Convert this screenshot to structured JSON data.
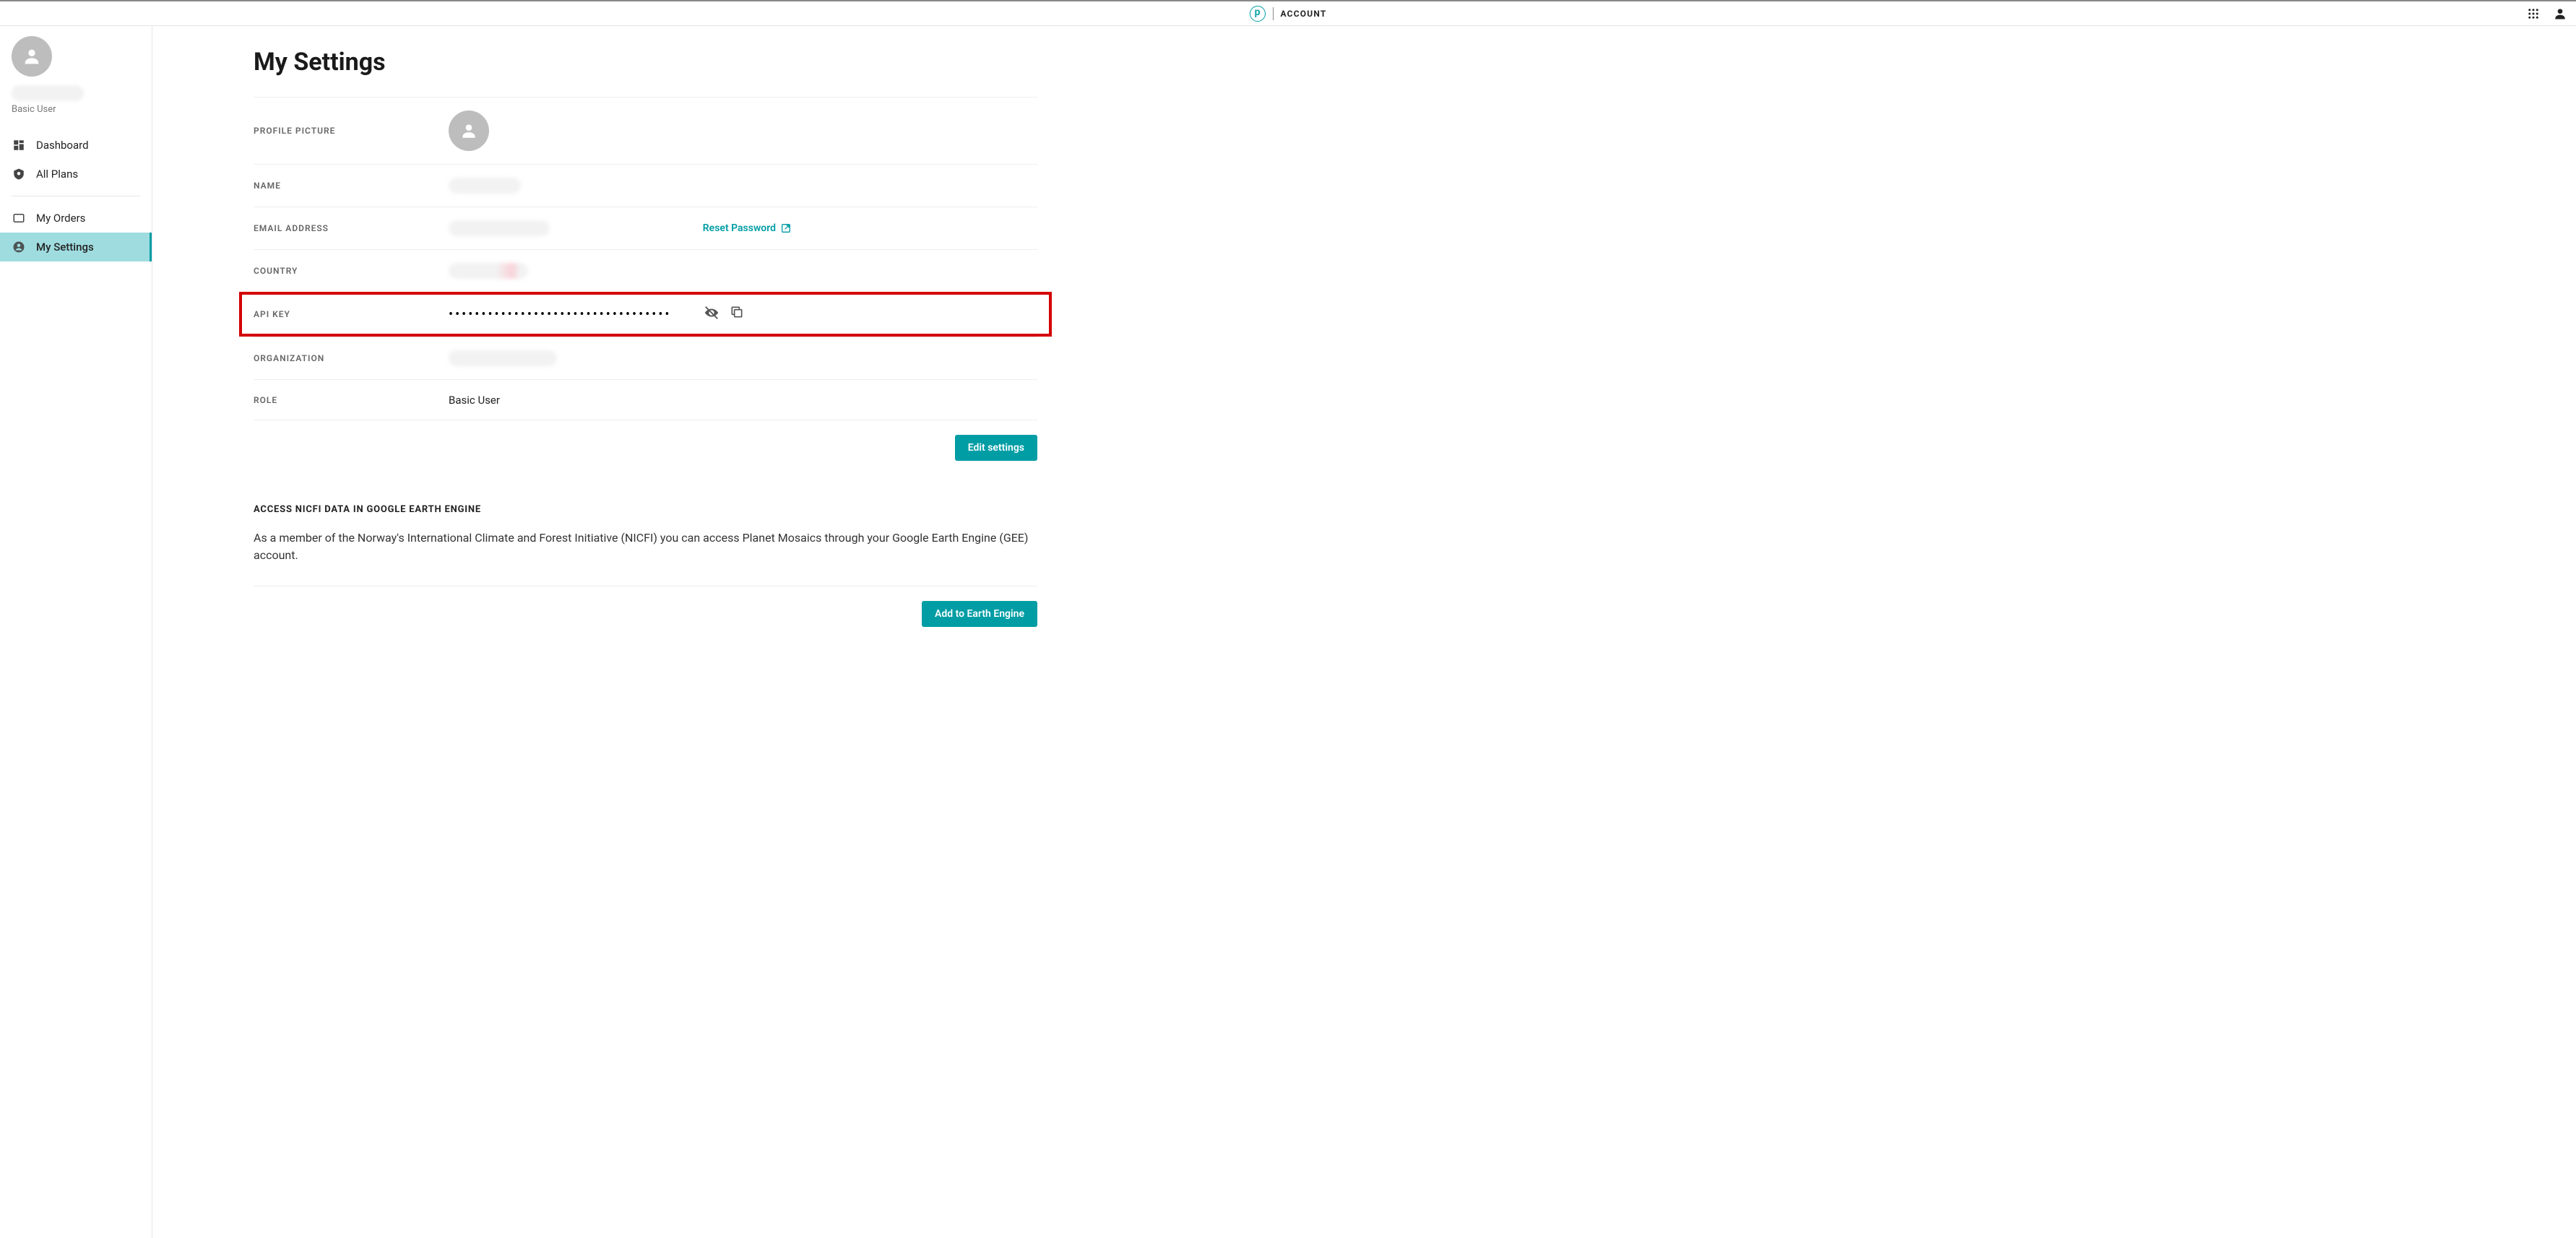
{
  "header": {
    "brand_letter": "p",
    "title": "ACCOUNT"
  },
  "sidebar": {
    "user_plan": "Basic User",
    "items": [
      {
        "label": "Dashboard"
      },
      {
        "label": "All Plans"
      },
      {
        "label": "My Orders"
      },
      {
        "label": "My Settings"
      }
    ]
  },
  "page": {
    "title": "My Settings",
    "fields": {
      "profile_picture_label": "Profile Picture",
      "name_label": "Name",
      "email_label": "Email Address",
      "reset_password": "Reset Password",
      "country_label": "Country",
      "api_key_label": "API Key",
      "api_key_masked": "••••••••••••••••••••••••••••••••••",
      "organization_label": "Organization",
      "role_label": "Role",
      "role_value": "Basic User"
    },
    "edit_button": "Edit settings",
    "nicfi": {
      "heading": "Access NICFI Data in Google Earth Engine",
      "body": "As a member of the Norway's International Climate and Forest Initiative (NICFI) you can access Planet Mosaics through your Google Earth Engine (GEE) account.",
      "button": "Add to Earth Engine"
    }
  }
}
